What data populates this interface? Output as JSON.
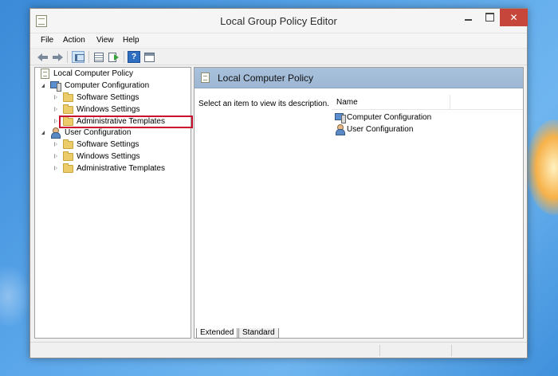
{
  "window": {
    "title": "Local Group Policy Editor",
    "close_glyph": "✕"
  },
  "menu": [
    "File",
    "Action",
    "View",
    "Help"
  ],
  "toolbar": {
    "help_glyph": "?"
  },
  "tree": {
    "root": "Local Computer Policy",
    "computer_config": {
      "label": "Computer Configuration",
      "children": [
        "Software Settings",
        "Windows Settings",
        "Administrative Templates"
      ]
    },
    "user_config": {
      "label": "User Configuration",
      "children": [
        "Software Settings",
        "Windows Settings",
        "Administrative Templates"
      ]
    },
    "highlighted_item": "Administrative Templates"
  },
  "details": {
    "header_title": "Local Computer Policy",
    "description": "Select an item to view its description.",
    "column_name": "Name",
    "items": [
      "Computer Configuration",
      "User Configuration"
    ]
  },
  "tabs": [
    "Extended",
    "Standard"
  ],
  "colors": {
    "highlight_border": "#c8102e",
    "header_blue": "#a9c1db",
    "close_red": "#c7463c"
  }
}
